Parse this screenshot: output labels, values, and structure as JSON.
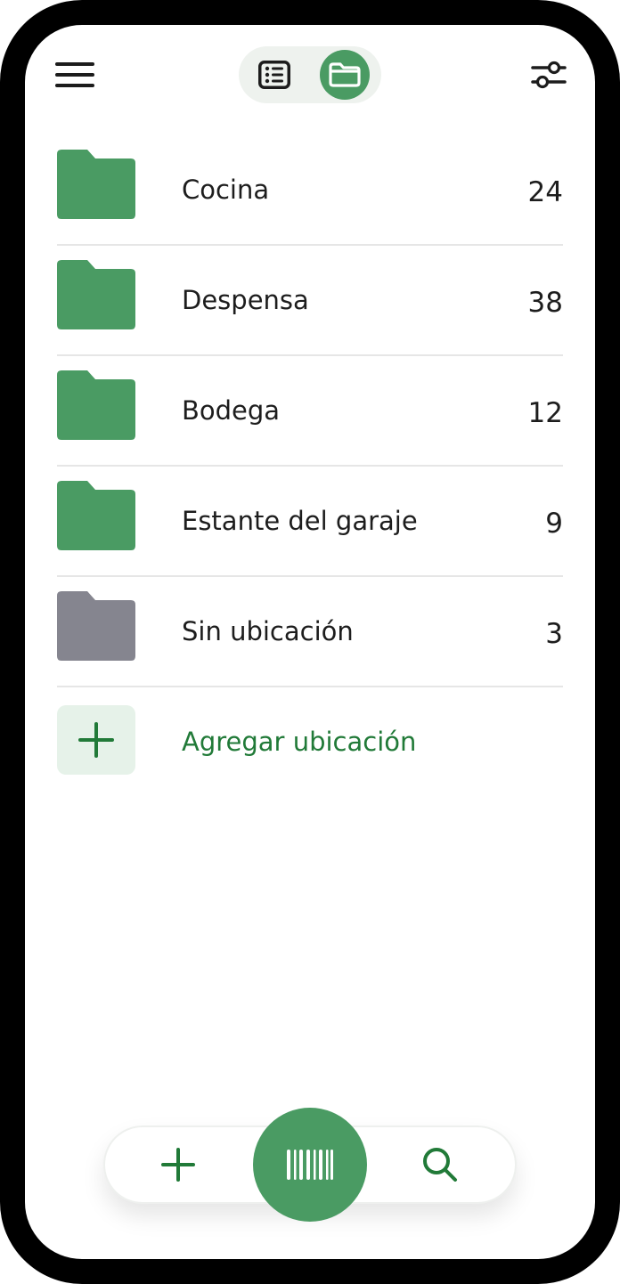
{
  "colors": {
    "accent": "#4a9b63",
    "accent_dark": "#217a38",
    "folder_green": "#4a9b63",
    "folder_gray": "#85858f",
    "text": "#1d1d1d",
    "divider": "#e6e6e6"
  },
  "header": {
    "menu_icon": "hamburger-menu-icon",
    "view_toggle": {
      "options": [
        {
          "icon": "list-view-icon",
          "selected": false
        },
        {
          "icon": "folder-view-icon",
          "selected": true
        }
      ]
    },
    "filter_icon": "sliders-filter-icon"
  },
  "locations": [
    {
      "name": "Cocina",
      "count": "24",
      "icon": "folder-icon",
      "color": "#4a9b63"
    },
    {
      "name": "Despensa",
      "count": "38",
      "icon": "folder-icon",
      "color": "#4a9b63"
    },
    {
      "name": "Bodega",
      "count": "12",
      "icon": "folder-icon",
      "color": "#4a9b63"
    },
    {
      "name": "Estante del garaje",
      "count": "9",
      "icon": "folder-icon",
      "color": "#4a9b63"
    },
    {
      "name": "Sin ubicación",
      "count": "3",
      "icon": "folder-icon",
      "color": "#85858f"
    }
  ],
  "add_location": {
    "label": "Agregar ubicación",
    "icon": "plus-icon"
  },
  "bottom_nav": {
    "add_icon": "plus-icon",
    "scan_icon": "barcode-icon",
    "search_icon": "search-icon"
  }
}
